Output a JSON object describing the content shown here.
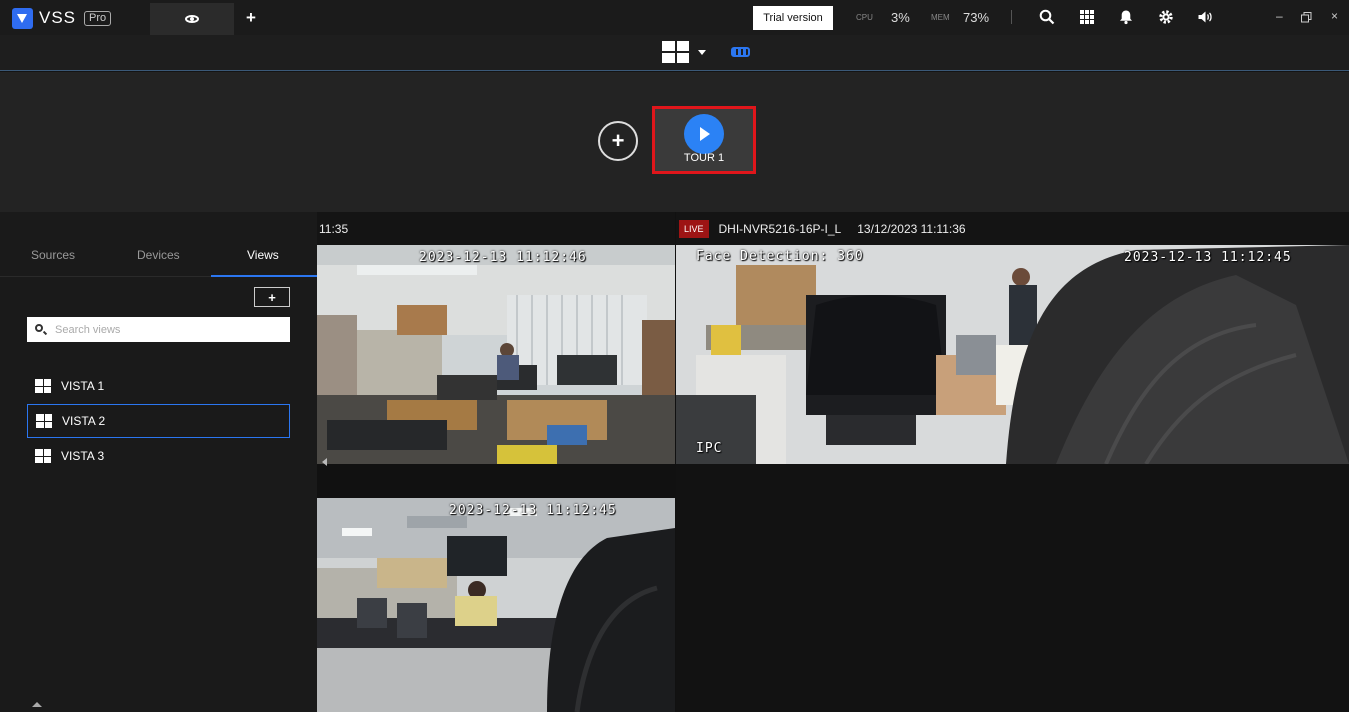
{
  "app": {
    "name": "VSS",
    "badge": "Pro"
  },
  "header": {
    "trial_label": "Trial version",
    "cpu_label": "CPU",
    "cpu_value": "3%",
    "mem_label": "MEM",
    "mem_value": "73%",
    "icons": [
      "search-icon",
      "apps-grid-icon",
      "bell-icon",
      "gear-icon",
      "volume-icon"
    ]
  },
  "tour": {
    "label": "TOUR 1"
  },
  "sidebar": {
    "tabs": [
      "Sources",
      "Devices",
      "Views"
    ],
    "active_tab": "Views",
    "add_label": "+",
    "search_placeholder": "Search views",
    "views": [
      {
        "label": "VISTA 1"
      },
      {
        "label": "VISTA 2",
        "selected": true
      },
      {
        "label": "VISTA 3"
      }
    ]
  },
  "feeds": {
    "left_header_time": "11:35",
    "right_header": {
      "live_label": "LIVE",
      "device": "DHI-NVR5216-16P-I_L",
      "timestamp": "13/12/2023 11:11:36"
    },
    "cam1_osd": "2023-12-13 11:12:46",
    "cam2_osd_title": "Face Detection: 360",
    "cam2_osd": "2023-12-13 11:12:45",
    "cam2_osd_bottom": "IPC",
    "cam3_osd": "2023-12-13 11:12:45"
  },
  "colors": {
    "accent": "#2b76f0",
    "highlight": "#e0161b",
    "live": "#9d1414"
  }
}
